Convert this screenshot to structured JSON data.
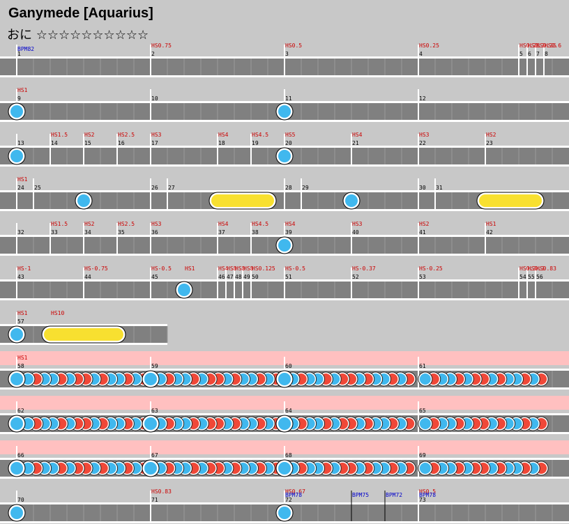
{
  "song": {
    "title": "Ganymede [Aquarius]",
    "difficulty_prefix": "おに",
    "stars_text": "☆☆☆☆☆☆☆☆☆☆"
  },
  "colors": {
    "don": "#f04838",
    "ka": "#40b8ee",
    "roll": "#f8e030",
    "hs_label": "#cc0000",
    "bpm_label": "#0000cc",
    "gogo_bg": "#ffc0c0"
  },
  "rows": [
    {
      "measures": [
        [
          "1",
          0
        ],
        [
          "2",
          1
        ],
        [
          "3",
          2
        ],
        [
          "4",
          3
        ],
        [
          "5",
          3.75
        ],
        [
          "6",
          3.8125
        ],
        [
          "7",
          3.875
        ],
        [
          "8",
          3.9375
        ]
      ],
      "hs": [
        [
          "HS0.75",
          1
        ],
        [
          "HS0.5",
          2
        ],
        [
          "HS0.25",
          3
        ],
        [
          "HS0.25",
          3.75
        ],
        [
          "HS0.3",
          3.8125
        ],
        [
          "HS0.35",
          3.875
        ],
        [
          "HS0.6",
          3.9375
        ]
      ],
      "bpm": [
        [
          "BPM82",
          0
        ]
      ],
      "notes": []
    },
    {
      "measures": [
        [
          "9",
          0
        ],
        [
          "10",
          1
        ],
        [
          "11",
          2
        ],
        [
          "12",
          3
        ]
      ],
      "hs": [
        [
          "HS1",
          0
        ]
      ],
      "bpm": [],
      "notes": [
        {
          "t": "ka",
          "p": 0
        },
        {
          "t": "ka",
          "p": 2
        }
      ]
    },
    {
      "measures": [
        [
          "13",
          0
        ],
        [
          "14",
          0.25
        ],
        [
          "15",
          0.5
        ],
        [
          "16",
          0.75
        ],
        [
          "17",
          1
        ],
        [
          "18",
          1.5
        ],
        [
          "19",
          1.75
        ],
        [
          "20",
          2
        ],
        [
          "21",
          2.5
        ],
        [
          "22",
          3
        ],
        [
          "23",
          3.5
        ]
      ],
      "hs": [
        [
          "HS1.5",
          0.25
        ],
        [
          "HS2",
          0.5
        ],
        [
          "HS2.5",
          0.75
        ],
        [
          "HS3",
          1
        ],
        [
          "HS4",
          1.5
        ],
        [
          "HS4.5",
          1.75
        ],
        [
          "HS5",
          2
        ],
        [
          "HS4",
          2.5
        ],
        [
          "HS3",
          3
        ],
        [
          "HS2",
          3.5
        ]
      ],
      "bpm": [],
      "notes": [
        {
          "t": "ka",
          "p": 0
        },
        {
          "t": "ka",
          "p": 2
        }
      ]
    },
    {
      "measures": [
        [
          "24",
          0
        ],
        [
          "25",
          0.125
        ],
        [
          "26",
          1
        ],
        [
          "27",
          1.125
        ],
        [
          "28",
          2
        ],
        [
          "29",
          2.125
        ],
        [
          "30",
          3
        ],
        [
          "31",
          3.125
        ]
      ],
      "hs": [
        [
          "HS1",
          0
        ]
      ],
      "bpm": [],
      "notes": [
        {
          "t": "ka",
          "p": 0.5
        },
        {
          "t": "roll",
          "p": 1.5,
          "e": 1.875
        },
        {
          "t": "ka",
          "p": 2.5
        },
        {
          "t": "roll",
          "p": 3.5,
          "e": 3.875
        }
      ]
    },
    {
      "measures": [
        [
          "32",
          0
        ],
        [
          "33",
          0.25
        ],
        [
          "34",
          0.5
        ],
        [
          "35",
          0.75
        ],
        [
          "36",
          1
        ],
        [
          "37",
          1.5
        ],
        [
          "38",
          1.75
        ],
        [
          "39",
          2
        ],
        [
          "40",
          2.5
        ],
        [
          "41",
          3
        ],
        [
          "42",
          3.5
        ]
      ],
      "hs": [
        [
          "HS1.5",
          0.25
        ],
        [
          "HS2",
          0.5
        ],
        [
          "HS2.5",
          0.75
        ],
        [
          "HS3",
          1
        ],
        [
          "HS4",
          1.5
        ],
        [
          "HS4.5",
          1.75
        ],
        [
          "HS4",
          2
        ],
        [
          "HS3",
          2.5
        ],
        [
          "HS2",
          3
        ],
        [
          "HS1",
          3.5
        ]
      ],
      "bpm": [],
      "notes": [
        {
          "t": "ka",
          "p": 2
        }
      ]
    },
    {
      "measures": [
        [
          "43",
          0
        ],
        [
          "44",
          0.5
        ],
        [
          "45",
          1
        ],
        [
          "46",
          1.5
        ],
        [
          "47",
          1.5625
        ],
        [
          "48",
          1.625
        ],
        [
          "49",
          1.6875
        ],
        [
          "50",
          1.75
        ],
        [
          "51",
          2
        ],
        [
          "52",
          2.5
        ],
        [
          "53",
          3
        ],
        [
          "54",
          3.75
        ],
        [
          "55",
          3.8125
        ],
        [
          "56",
          3.875
        ]
      ],
      "hs": [
        [
          "HS-1",
          0
        ],
        [
          "HS-0.75",
          0.5
        ],
        [
          "HS-0.5",
          1
        ],
        [
          "HS1",
          1.25
        ],
        [
          "HS4",
          1.5
        ],
        [
          "HS8",
          1.5625
        ],
        [
          "HS8",
          1.625
        ],
        [
          "HS8",
          1.6875
        ],
        [
          "HS0.125",
          1.75
        ],
        [
          "HS-0.5",
          2
        ],
        [
          "HS-0.37",
          2.5
        ],
        [
          "HS-0.25",
          3
        ],
        [
          "HS0.3",
          3.75
        ],
        [
          "HS0.3",
          3.8125
        ],
        [
          "HS0.83",
          3.875
        ]
      ],
      "bpm": [],
      "notes": [
        {
          "t": "ka",
          "p": 1.25
        }
      ]
    },
    {
      "measures": [
        [
          "57",
          0
        ]
      ],
      "hs": [
        [
          "HS1",
          0
        ],
        [
          "HS10",
          0.25
        ]
      ],
      "bpm": [],
      "notes": [
        {
          "t": "ka",
          "p": 0
        },
        {
          "t": "roll",
          "p": 0.25,
          "e": 0.75
        }
      ]
    },
    {
      "gogo": true,
      "measures": [
        [
          "58",
          0
        ],
        [
          "59",
          1
        ],
        [
          "60",
          2
        ],
        [
          "61",
          3
        ]
      ],
      "hs": [
        [
          "HS1",
          0
        ]
      ],
      "bpm": [],
      "stream": true
    },
    {
      "gogo": true,
      "measures": [
        [
          "62",
          0
        ],
        [
          "63",
          1
        ],
        [
          "64",
          2
        ],
        [
          "65",
          3
        ]
      ],
      "hs": [],
      "bpm": [],
      "stream": true
    },
    {
      "gogo": true,
      "measures": [
        [
          "66",
          0
        ],
        [
          "67",
          1
        ],
        [
          "68",
          2
        ],
        [
          "69",
          3
        ]
      ],
      "hs": [],
      "bpm": [],
      "stream": true
    },
    {
      "measures": [
        [
          "70",
          0
        ],
        [
          "71",
          1
        ],
        [
          "72",
          2
        ],
        [
          "73",
          3
        ]
      ],
      "hs": [
        [
          "HS0.83",
          1
        ],
        [
          "HS0.67",
          2
        ],
        [
          "HS0.5",
          3
        ]
      ],
      "bpm": [
        [
          "BPM78",
          2
        ],
        [
          "BPM75",
          2.5
        ],
        [
          "BPM72",
          2.75
        ],
        [
          "BPM78",
          3
        ]
      ],
      "notes": [
        {
          "t": "ka",
          "p": 0
        },
        {
          "t": "ka",
          "p": 2
        }
      ]
    }
  ]
}
